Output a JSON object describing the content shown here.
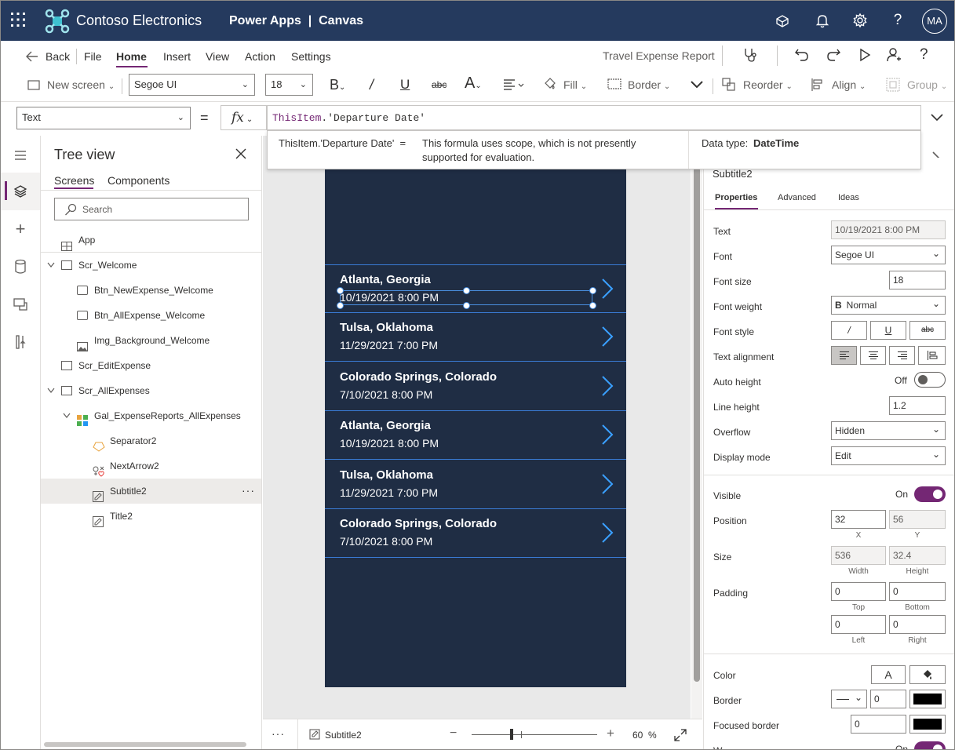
{
  "header": {
    "brand": "Contoso Electronics",
    "app_title": "Power Apps  |  Canvas",
    "avatar_initials": "MA",
    "accent": "#742774",
    "bg": "#253a5e"
  },
  "menu": {
    "back": "Back",
    "items": [
      "File",
      "Home",
      "Insert",
      "View",
      "Action",
      "Settings"
    ],
    "active": "Home",
    "app_name": "Travel Expense Report"
  },
  "toolbar": {
    "new_screen": "New screen",
    "font": "Segoe UI",
    "font_size": "18",
    "fill": "Fill",
    "border": "Border",
    "reorder": "Reorder",
    "align": "Align",
    "group": "Group"
  },
  "formula": {
    "property": "Text",
    "fx": "fx",
    "keyword": "ThisItem",
    "rest": ".'Departure Date'",
    "hint_expr": "ThisItem.'Departure Date'  =",
    "hint_msg_1": "This formula uses scope, which is not presently",
    "hint_msg_2": "supported for evaluation.",
    "data_type_label": "Data type:",
    "data_type": "DateTime"
  },
  "tree": {
    "title": "Tree view",
    "tabs": [
      "Screens",
      "Components"
    ],
    "search_placeholder": "Search",
    "items": [
      {
        "label": "App",
        "level": 0
      },
      {
        "label": "Scr_Welcome",
        "level": 0
      },
      {
        "label": "Btn_NewExpense_Welcome",
        "level": 1
      },
      {
        "label": "Btn_AllExpense_Welcome",
        "level": 1
      },
      {
        "label": "Img_Background_Welcome",
        "level": 1
      },
      {
        "label": "Scr_EditExpense",
        "level": 0
      },
      {
        "label": "Scr_AllExpenses",
        "level": 0
      },
      {
        "label": "Gal_ExpenseReports_AllExpenses",
        "level": 1
      },
      {
        "label": "Separator2",
        "level": 2
      },
      {
        "label": "NextArrow2",
        "level": 2
      },
      {
        "label": "Subtitle2",
        "level": 2
      },
      {
        "label": "Title2",
        "level": 2
      }
    ],
    "selected": "Subtitle2",
    "more": "···"
  },
  "gallery": [
    {
      "title": "Atlanta, Georgia",
      "date": "10/19/2021 8:00 PM"
    },
    {
      "title": "Tulsa, Oklahoma",
      "date": "11/29/2021 7:00 PM"
    },
    {
      "title": "Colorado Springs, Colorado",
      "date": "7/10/2021 8:00 PM"
    },
    {
      "title": "Atlanta, Georgia",
      "date": "10/19/2021 8:00 PM"
    },
    {
      "title": "Tulsa, Oklahoma",
      "date": "11/29/2021 7:00 PM"
    },
    {
      "title": "Colorado Springs, Colorado",
      "date": "7/10/2021 8:00 PM"
    }
  ],
  "status": {
    "more": "···",
    "selected": "Subtitle2",
    "minus": "−",
    "plus": "+",
    "zoom": "60",
    "pct": "%"
  },
  "props": {
    "control": "Subtitle2",
    "tabs": [
      "Properties",
      "Advanced",
      "Ideas"
    ],
    "text_label": "Text",
    "text_value": "10/19/2021 8:00 PM",
    "font_label": "Font",
    "font_value": "Segoe UI",
    "font_size_label": "Font size",
    "font_size_value": "18",
    "font_weight_label": "Font weight",
    "font_weight_value": "Normal",
    "font_weight_glyph": "B",
    "font_style_label": "Font style",
    "text_align_label": "Text alignment",
    "auto_height_label": "Auto height",
    "auto_height_state": "Off",
    "line_height_label": "Line height",
    "line_height_value": "1.2",
    "overflow_label": "Overflow",
    "overflow_value": "Hidden",
    "display_mode_label": "Display mode",
    "display_mode_value": "Edit",
    "visible_label": "Visible",
    "visible_state": "On",
    "position_label": "Position",
    "x": "32",
    "y": "56",
    "x_label": "X",
    "y_label": "Y",
    "size_label": "Size",
    "width": "536",
    "height": "32.4",
    "width_label": "Width",
    "height_label": "Height",
    "padding_label": "Padding",
    "pad_top": "0",
    "pad_bottom": "0",
    "pad_left": "0",
    "pad_right": "0",
    "top_label": "Top",
    "bottom_label": "Bottom",
    "left_label": "Left",
    "right_label": "Right",
    "color_label": "Color",
    "color_glyph": "A",
    "border_label": "Border",
    "border_value": "0",
    "focused_border_label": "Focused border",
    "focused_border_value": "0",
    "wrap_label": "W",
    "wrap_state": "On"
  }
}
